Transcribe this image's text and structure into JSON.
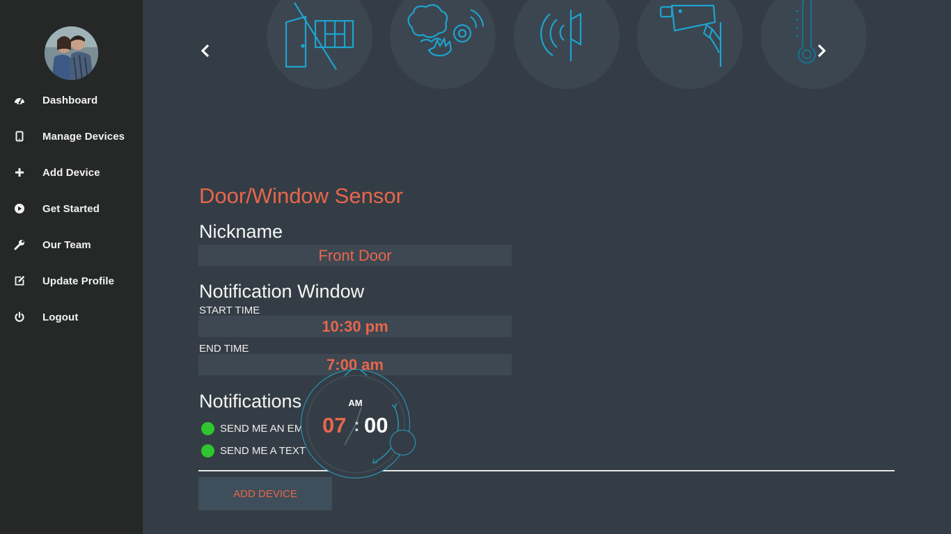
{
  "sidebar": {
    "items": [
      {
        "label": "Dashboard",
        "icon": "dashboard-icon"
      },
      {
        "label": "Manage Devices",
        "icon": "tablet-icon"
      },
      {
        "label": "Add Device",
        "icon": "plus-icon"
      },
      {
        "label": "Get Started",
        "icon": "play-circle-icon"
      },
      {
        "label": "Our Team",
        "icon": "wrench-icon"
      },
      {
        "label": "Update Profile",
        "icon": "edit-icon"
      },
      {
        "label": "Logout",
        "icon": "power-icon"
      }
    ]
  },
  "carousel": {
    "devices": [
      "door-window-sensor-icon",
      "smoke-detector-icon",
      "siren-speaker-icon",
      "security-camera-icon",
      "thermometer-icon"
    ],
    "icon_color": "#1fa3cf"
  },
  "form": {
    "device_title": "Door/Window Sensor",
    "nickname_label": "Nickname",
    "nickname_value": "Front Door",
    "notification_window_label": "Notification Window",
    "start_time_label": "START TIME",
    "start_time_value": "10:30 pm",
    "end_time_label": "END TIME",
    "end_time_value": "7:00 am",
    "notifications_label": "Notifications",
    "options": [
      {
        "label": "SEND ME AN EMAIL",
        "checked": true
      },
      {
        "label": "SEND ME A TEXT",
        "checked": true
      }
    ],
    "submit_label": "ADD DEVICE"
  },
  "clock_picker": {
    "ampm": "AM",
    "hour": "07",
    "separator": ":",
    "minute": "00"
  },
  "colors": {
    "accent": "#e8664c",
    "sidebar_bg": "#262828",
    "main_bg": "#343d45",
    "check_green": "#2fc52f",
    "icon_blue": "#1fa3cf"
  }
}
